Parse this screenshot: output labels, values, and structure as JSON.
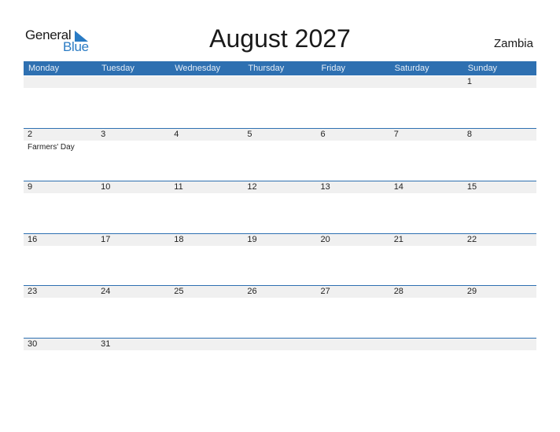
{
  "logo": {
    "general": "General",
    "blue": "Blue"
  },
  "title": "August 2027",
  "country": "Zambia",
  "days": [
    "Monday",
    "Tuesday",
    "Wednesday",
    "Thursday",
    "Friday",
    "Saturday",
    "Sunday"
  ],
  "weeks": [
    [
      {
        "d": ""
      },
      {
        "d": ""
      },
      {
        "d": ""
      },
      {
        "d": ""
      },
      {
        "d": ""
      },
      {
        "d": ""
      },
      {
        "d": "1"
      }
    ],
    [
      {
        "d": "2",
        "h": "Farmers' Day"
      },
      {
        "d": "3"
      },
      {
        "d": "4"
      },
      {
        "d": "5"
      },
      {
        "d": "6"
      },
      {
        "d": "7"
      },
      {
        "d": "8"
      }
    ],
    [
      {
        "d": "9"
      },
      {
        "d": "10"
      },
      {
        "d": "11"
      },
      {
        "d": "12"
      },
      {
        "d": "13"
      },
      {
        "d": "14"
      },
      {
        "d": "15"
      }
    ],
    [
      {
        "d": "16"
      },
      {
        "d": "17"
      },
      {
        "d": "18"
      },
      {
        "d": "19"
      },
      {
        "d": "20"
      },
      {
        "d": "21"
      },
      {
        "d": "22"
      }
    ],
    [
      {
        "d": "23"
      },
      {
        "d": "24"
      },
      {
        "d": "25"
      },
      {
        "d": "26"
      },
      {
        "d": "27"
      },
      {
        "d": "28"
      },
      {
        "d": "29"
      }
    ],
    [
      {
        "d": "30"
      },
      {
        "d": "31"
      },
      {
        "d": ""
      },
      {
        "d": ""
      },
      {
        "d": ""
      },
      {
        "d": ""
      },
      {
        "d": ""
      }
    ]
  ],
  "colors": {
    "accent": "#2e70b1",
    "logo_blue": "#2a7bc4",
    "strip": "#f0f0f0"
  }
}
